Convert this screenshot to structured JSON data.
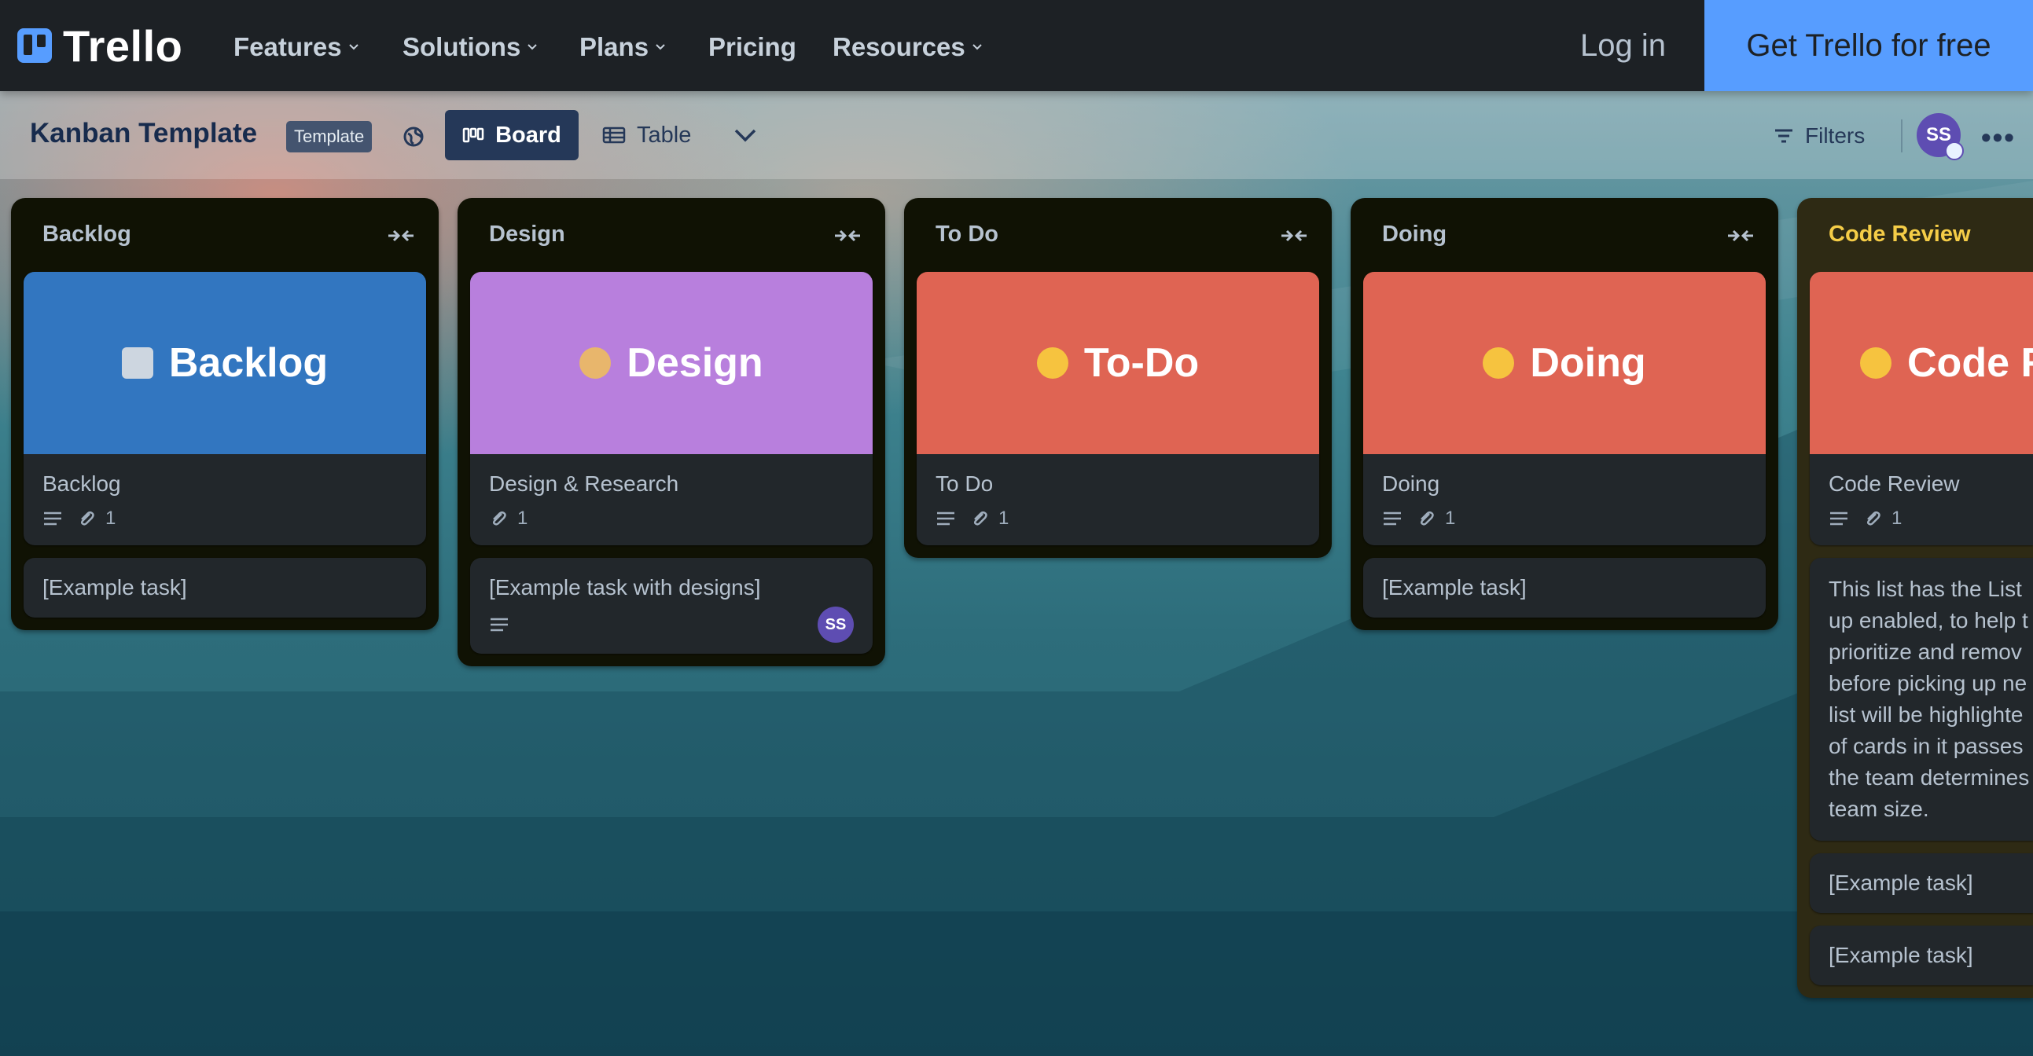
{
  "colors": {
    "nav_bg": "#1d2125",
    "cta_bg": "#579dff",
    "list_bg": "#101204",
    "card_bg": "#22272b",
    "code_review_list_bg": "#2e2a14",
    "code_review_title": "#f5cd47"
  },
  "nav": {
    "logo": "Trello",
    "items": [
      "Features",
      "Solutions",
      "Plans",
      "Pricing",
      "Resources"
    ],
    "login": "Log in",
    "cta": "Get Trello for free"
  },
  "board": {
    "title": "Kanban Template",
    "badge": "Template",
    "views": {
      "board": "Board",
      "table": "Table"
    },
    "filters": "Filters",
    "avatar": "SS"
  },
  "lists": [
    {
      "title": "Backlog",
      "cover": {
        "text": "Backlog",
        "color": "#3276c0",
        "emoji_icon": "inbox-tray-icon"
      },
      "card_name": "Backlog",
      "attachments": "1",
      "extra_card": "[Example task]"
    },
    {
      "title": "Design",
      "cover": {
        "text": "Design",
        "color": "#b87fdd",
        "emoji_icon": "artist-palette-icon"
      },
      "card_name": "Design & Research",
      "attachments": "1",
      "extra_card": "[Example task with designs]",
      "extra_card_avatar": "SS"
    },
    {
      "title": "To Do",
      "cover": {
        "text": "To-Do",
        "color": "#df6453",
        "emoji_icon": "thinking-face-icon"
      },
      "card_name": "To Do",
      "attachments": "1"
    },
    {
      "title": "Doing",
      "cover": {
        "text": "Doing",
        "color": "#df6453",
        "emoji_icon": "nerd-face-icon"
      },
      "card_name": "Doing",
      "attachments": "1",
      "extra_card": "[Example task]"
    },
    {
      "title": "Code Review",
      "cover": {
        "text": "Code R",
        "color": "#df6453",
        "emoji_icon": "grimacing-face-icon"
      },
      "card_name": "Code Review",
      "attachments": "1",
      "note_lines": [
        "This list has the List",
        "up enabled, to help t",
        "prioritize and remov",
        "before picking up ne",
        "list will be highlighte",
        "of cards in it passes",
        "the team determines",
        "team size."
      ],
      "extra_cards": [
        "[Example task]",
        "[Example task]"
      ]
    }
  ]
}
